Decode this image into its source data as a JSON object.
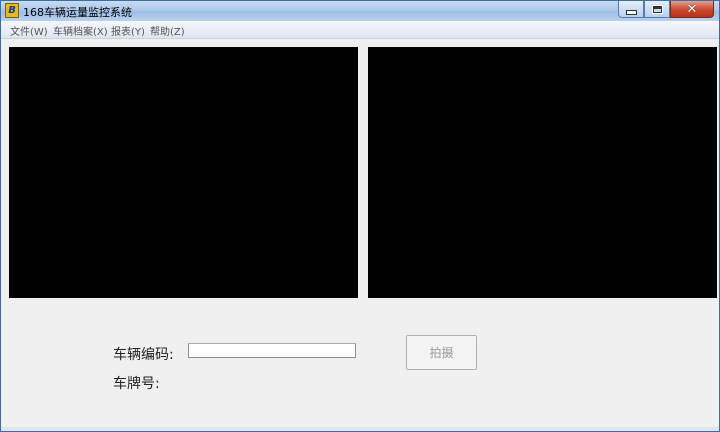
{
  "window": {
    "title": "168车辆运量监控系统",
    "icon": "app-logo-icon",
    "icon_glyph": "B"
  },
  "menu": [
    {
      "label": "文件(W)"
    },
    {
      "label": "车辆档案(X)"
    },
    {
      "label": "报表(Y)"
    },
    {
      "label": "帮助(Z)"
    }
  ],
  "form": {
    "vehicle_code_label": "车辆编码:",
    "vehicle_code_value": "",
    "plate_label": "车牌号:",
    "capture_button": "拍摄"
  },
  "colors": {
    "video_background": "#000000",
    "window_background": "#f0f0f0"
  }
}
